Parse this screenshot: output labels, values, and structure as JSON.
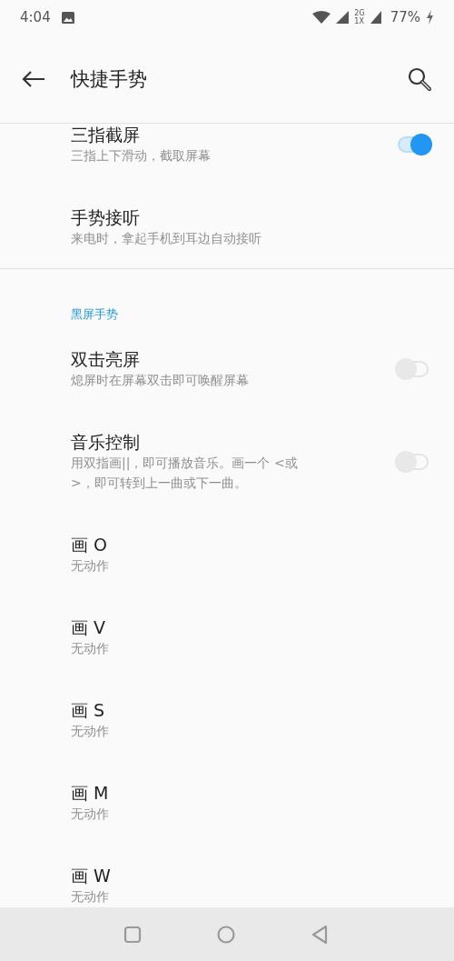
{
  "status_bar": {
    "time": "4:04",
    "network_top": "2G",
    "network_bottom": "1X",
    "battery": "77%"
  },
  "header": {
    "title": "快捷手势"
  },
  "groups": [
    {
      "items": [
        {
          "kind": "toggle",
          "title": "三指截屏",
          "subtitle": "三指上下滑动，截取屏幕",
          "on": true
        },
        {
          "kind": "plain",
          "title": "手势接听",
          "subtitle": "来电时，拿起手机到耳边自动接听"
        }
      ]
    },
    {
      "section_title": "黑屏手势",
      "items": [
        {
          "kind": "toggle",
          "title": "双击亮屏",
          "subtitle": "熄屏时在屏幕双击即可唤醒屏幕",
          "on": false
        },
        {
          "kind": "toggle",
          "title": "音乐控制",
          "subtitle": "用双指画||，即可播放音乐。画一个 <或 >，即可转到上一曲或下一曲。",
          "on": false
        },
        {
          "kind": "plain",
          "title": "画 O",
          "subtitle": "无动作"
        },
        {
          "kind": "plain",
          "title": "画 V",
          "subtitle": "无动作"
        },
        {
          "kind": "plain",
          "title": "画 S",
          "subtitle": "无动作"
        },
        {
          "kind": "plain",
          "title": "画 M",
          "subtitle": "无动作"
        },
        {
          "kind": "plain",
          "title": "画 W",
          "subtitle": "无动作"
        }
      ]
    }
  ]
}
